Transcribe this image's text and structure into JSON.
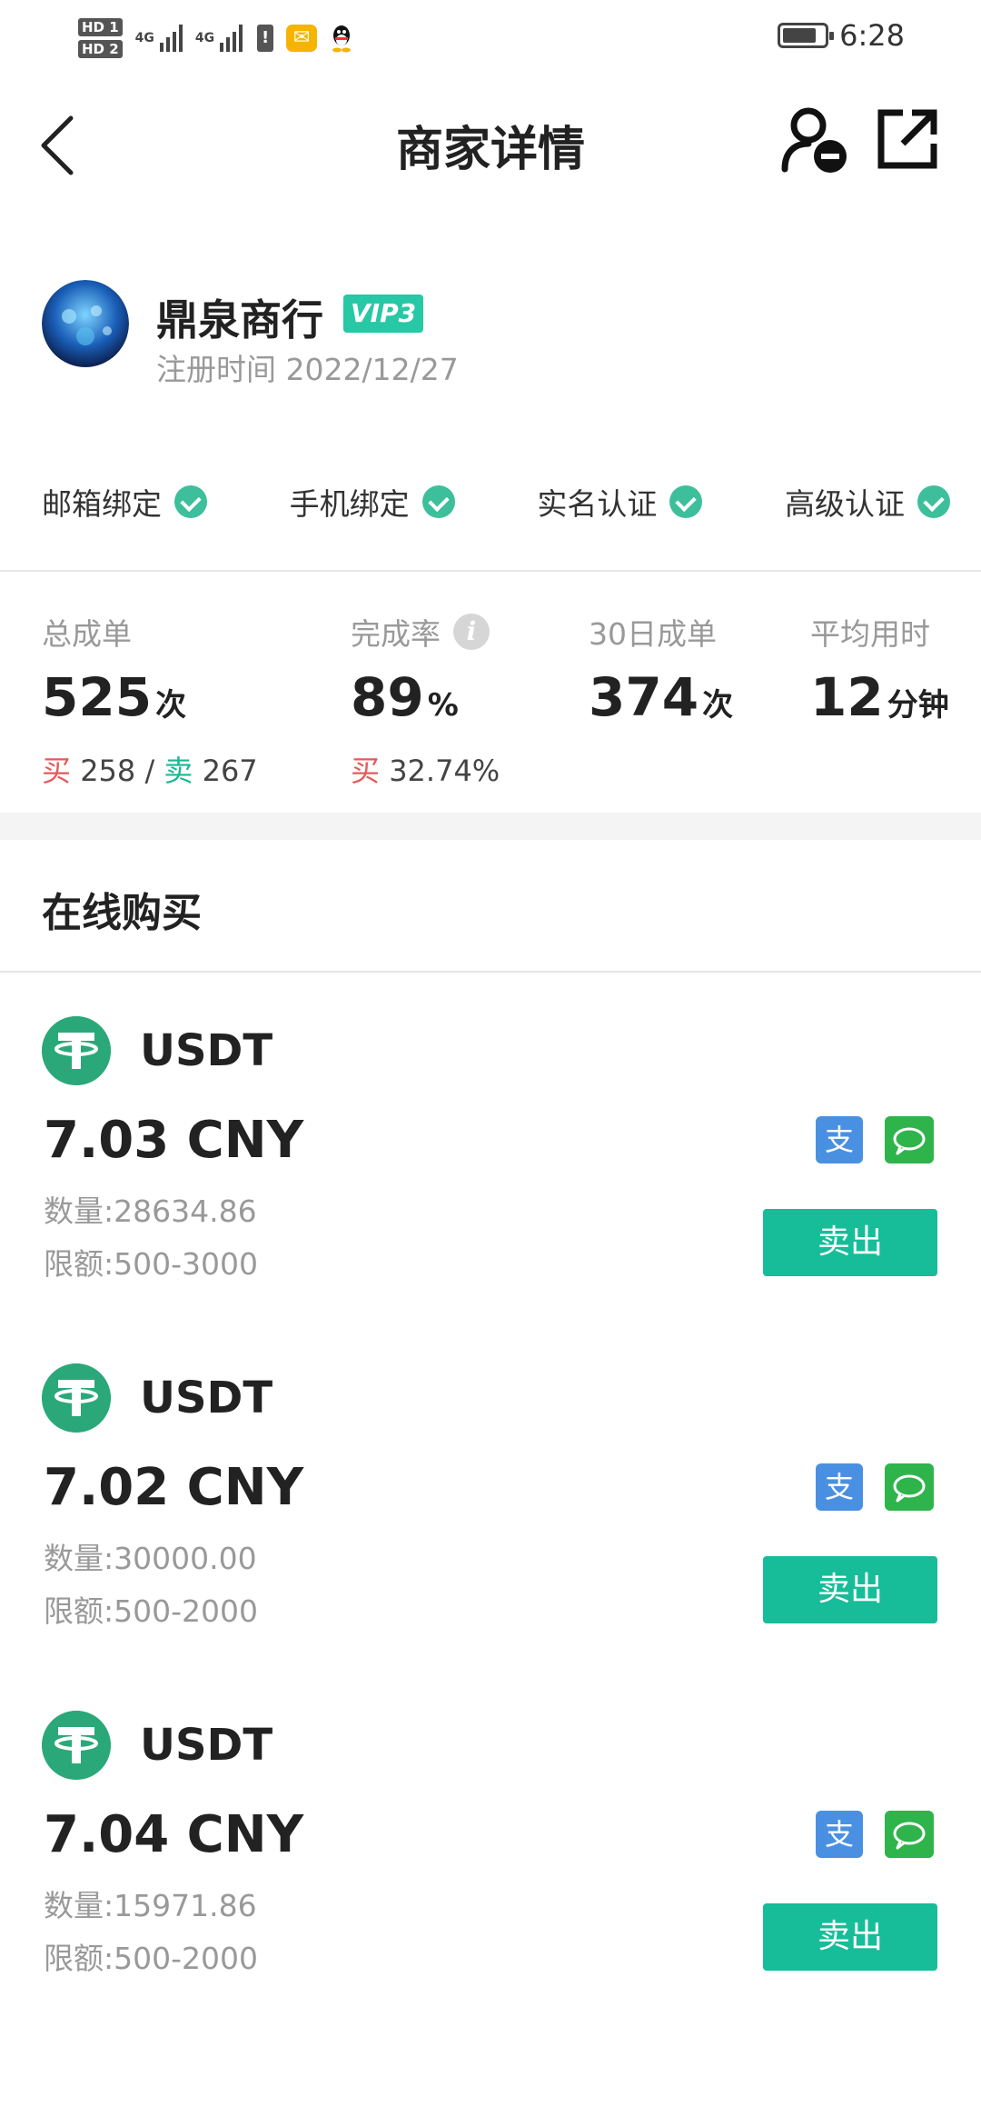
{
  "status_bar": {
    "hd1": "HD 1",
    "hd2": "HD 2",
    "network1": "4G",
    "network2": "4G",
    "time": "6:28"
  },
  "header": {
    "title": "商家详情",
    "back_icon": "chevron-left-icon",
    "user_icon": "user-minus-icon",
    "share_icon": "external-link-icon"
  },
  "merchant": {
    "name": "鼎泉商行",
    "vip": "VIP3",
    "register_time": "注册时间 2022/12/27"
  },
  "verifications": [
    {
      "label": "邮箱绑定",
      "verified": true
    },
    {
      "label": "手机绑定",
      "verified": true
    },
    {
      "label": "实名认证",
      "verified": true
    },
    {
      "label": "高级认证",
      "verified": true
    }
  ],
  "stats": {
    "total_orders": {
      "label": "总成单",
      "value": "525",
      "unit": "次",
      "buy_label": "买",
      "buy_value": "258",
      "separator": "/",
      "sell_label": "卖",
      "sell_value": "267"
    },
    "completion_rate": {
      "label": "完成率",
      "value": "89",
      "unit": "%",
      "buy_label": "买",
      "buy_value": "32.74%"
    },
    "orders_30d": {
      "label": "30日成单",
      "value": "374",
      "unit": "次"
    },
    "avg_time": {
      "label": "平均用时",
      "value": "12",
      "unit": "分钟"
    }
  },
  "section_title": "在线购买",
  "offers": [
    {
      "coin": "USDT",
      "price": "7.03 CNY",
      "quantity": "数量:28634.86",
      "limit": "限额:500-3000",
      "pay_ali": "支",
      "sell_label": "卖出"
    },
    {
      "coin": "USDT",
      "price": "7.02 CNY",
      "quantity": "数量:30000.00",
      "limit": "限额:500-2000",
      "pay_ali": "支",
      "sell_label": "卖出"
    },
    {
      "coin": "USDT",
      "price": "7.04 CNY",
      "quantity": "数量:15971.86",
      "limit": "限额:500-2000",
      "pay_ali": "支",
      "sell_label": "卖出"
    }
  ],
  "colors": {
    "accent": "#16bd98",
    "vip_badge": "#27c8a5",
    "buy_red": "#e45a5a",
    "sell_green": "#1bb894",
    "alipay_blue": "#4a90e2",
    "wechat_green": "#2fb44c"
  }
}
